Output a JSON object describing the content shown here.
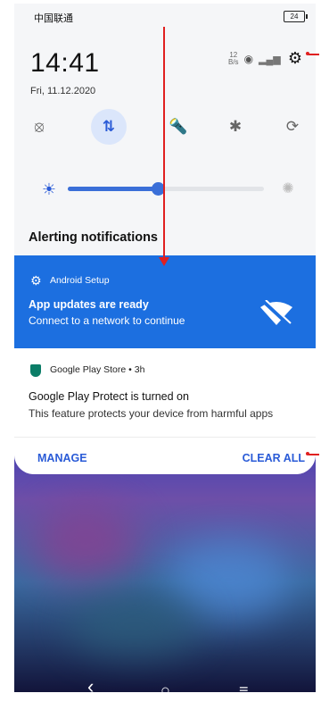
{
  "status_bar": {
    "carrier": "中国联通",
    "battery": "24",
    "net_speed_top": "12",
    "net_speed_bottom": "B/s"
  },
  "header": {
    "time": "14:41",
    "date": "Fri, 11.12.2020"
  },
  "quick_settings": [
    {
      "name": "wifi-off-icon",
      "glyph": "⦻",
      "active": false
    },
    {
      "name": "mobile-data-icon",
      "glyph": "⇅",
      "active": true
    },
    {
      "name": "flashlight-icon",
      "glyph": "🔦",
      "active": false
    },
    {
      "name": "bluetooth-off-icon",
      "glyph": "✱",
      "active": false
    },
    {
      "name": "auto-rotate-icon",
      "glyph": "⟳",
      "active": false
    }
  ],
  "brightness": {
    "level": 0.46
  },
  "notifications_header": "Alerting notifications",
  "notification_setup": {
    "app": "Android Setup",
    "title": "App updates are ready",
    "text": "Connect to a network to continue"
  },
  "notification_play": {
    "app": "Google Play Store",
    "time": "3h",
    "title": "Google Play Protect is turned on",
    "text": "This feature protects your device from harmful apps"
  },
  "actions": {
    "manage": "MANAGE",
    "clear_all": "CLEAR ALL"
  },
  "navigation": {
    "back": "‹",
    "home": "○",
    "recents": "≡"
  },
  "colors": {
    "accent": "#2a5bd7",
    "notification_blue": "#1c6fe0",
    "annotation_red": "#e02020"
  }
}
